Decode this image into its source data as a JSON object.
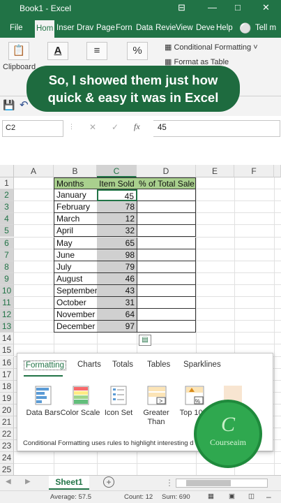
{
  "window": {
    "title": "Book1  -  Excel",
    "minimize": "—",
    "restore": "□",
    "close": "✕",
    "ribbon_display": "⊟"
  },
  "ribbon_tabs": [
    "File",
    "Hom",
    "Inser",
    "Drav",
    "Page",
    "Forn",
    "Data",
    "Revie",
    "View",
    "Deve",
    "Help",
    "Tell m"
  ],
  "ribbon": {
    "clipboard_label": "Clipboard",
    "conditional_formatting": "Conditional Formatting",
    "format_as_table": "Format as Table",
    "percent": "%"
  },
  "caption": {
    "line1": "So, I showed them just how",
    "line2": "quick & easy it was in Excel"
  },
  "formula_bar": {
    "name_box": "C2",
    "cancel": "✕",
    "enter": "✓",
    "fx": "fx",
    "value": "45"
  },
  "columns": [
    "A",
    "B",
    "C",
    "D",
    "E",
    "F"
  ],
  "rows": [
    "1",
    "2",
    "3",
    "4",
    "5",
    "6",
    "7",
    "8",
    "9",
    "10",
    "11",
    "12",
    "13",
    "14",
    "15",
    "16",
    "17",
    "18",
    "19",
    "20",
    "21",
    "22",
    "23",
    "24",
    "25"
  ],
  "table": {
    "headers": [
      "Months",
      "Item Sold",
      "% of Total Sale"
    ],
    "months": [
      "January",
      "February",
      "March",
      "April",
      "May",
      "June",
      "July",
      "August",
      "September",
      "October",
      "November",
      "December"
    ],
    "items_sold": [
      45,
      78,
      12,
      32,
      65,
      98,
      79,
      46,
      43,
      31,
      64,
      97
    ]
  },
  "quick_analysis": {
    "tabs": [
      "Formatting",
      "Charts",
      "Totals",
      "Tables",
      "Sparklines"
    ],
    "options": [
      {
        "label": "Data Bars",
        "icon": "data-bars-icon"
      },
      {
        "label": "Color Scale",
        "icon": "color-scale-icon"
      },
      {
        "label": "Icon Set",
        "icon": "icon-set-icon"
      },
      {
        "label": "Greater Than",
        "icon": "greater-than-icon"
      },
      {
        "label": "Top 10%",
        "icon": "top-ten-icon"
      }
    ],
    "description": "Conditional Formatting uses rules to highlight interesting d"
  },
  "watermark": {
    "letter": "C",
    "name": "Courseaim"
  },
  "sheets": {
    "active": "Sheet1",
    "add": "+"
  },
  "status": {
    "average": "Average: 57.5",
    "count": "Count: 12",
    "sum": "Sum: 690"
  },
  "colors": {
    "excel_green": "#217346",
    "header_fill": "#a9d08e",
    "selection_grey": "#d0d0d0"
  }
}
